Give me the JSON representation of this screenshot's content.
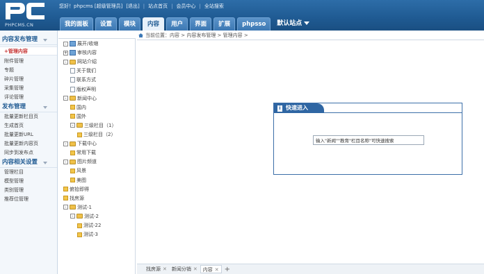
{
  "logo": {
    "brand": "PC",
    "domain": "PHPCMS.CN"
  },
  "userbar": {
    "greeting": "您好！phpcms [超级管理员]",
    "logout": "[退出]",
    "site_home": "站点首页",
    "member_center": "会员中心",
    "search": "全站搜索"
  },
  "nav": {
    "tabs": [
      "我的面板",
      "设置",
      "模块",
      "内容",
      "用户",
      "界面",
      "扩展",
      "phpsso"
    ],
    "active": "内容",
    "site_select": "默认站点"
  },
  "sidebar": {
    "sections": [
      {
        "title": "内容发布管理",
        "items": [
          "管理内容",
          "附件管理",
          "专题",
          "碎片管理",
          "采集管理",
          "评论管理"
        ],
        "current": "管理内容"
      },
      {
        "title": "发布管理",
        "items": [
          "批量更新栏目页",
          "生成首页",
          "批量更新URL",
          "批量更新内容页",
          "同步到发布点"
        ]
      },
      {
        "title": "内容相关设置",
        "items": [
          "管理栏目",
          "模型管理",
          "类别管理",
          "推荐位管理"
        ]
      }
    ]
  },
  "tree": {
    "nodes": [
      {
        "label": "展开/收缩",
        "indent": 0,
        "kind": "toggle"
      },
      {
        "label": "审核内容",
        "indent": 0,
        "kind": "page"
      },
      {
        "label": "网站介绍",
        "indent": 0,
        "kind": "folder"
      },
      {
        "label": "关于我们",
        "indent": 1,
        "kind": "doc"
      },
      {
        "label": "联系方式",
        "indent": 1,
        "kind": "doc"
      },
      {
        "label": "版权声明",
        "indent": 1,
        "kind": "doc"
      },
      {
        "label": "新闻中心",
        "indent": 0,
        "kind": "folder"
      },
      {
        "label": "国内",
        "indent": 1,
        "kind": "leaf"
      },
      {
        "label": "国外",
        "indent": 1,
        "kind": "leaf"
      },
      {
        "label": "三级栏目（1）",
        "indent": 1,
        "kind": "folder"
      },
      {
        "label": "三级栏目（2）",
        "indent": 2,
        "kind": "leaf"
      },
      {
        "label": "下载中心",
        "indent": 0,
        "kind": "folder"
      },
      {
        "label": "常用下载",
        "indent": 1,
        "kind": "leaf"
      },
      {
        "label": "图片频道",
        "indent": 0,
        "kind": "folder"
      },
      {
        "label": "风景",
        "indent": 1,
        "kind": "leaf"
      },
      {
        "label": "美图",
        "indent": 1,
        "kind": "leaf"
      },
      {
        "label": "俯拾即得",
        "indent": 0,
        "kind": "leaf"
      },
      {
        "label": "找房源",
        "indent": 0,
        "kind": "leaf"
      },
      {
        "label": "测试-1",
        "indent": 0,
        "kind": "folder"
      },
      {
        "label": "测试-2",
        "indent": 1,
        "kind": "folder"
      },
      {
        "label": "测试-22",
        "indent": 2,
        "kind": "leaf"
      },
      {
        "label": "测试-3",
        "indent": 2,
        "kind": "leaf"
      }
    ]
  },
  "breadcrumb": "当前位置：内容 > 内容发布管理 > 管理内容 >",
  "quick": {
    "title": "快速进入",
    "placeholder": "输入\"新闻\"\"教育\"栏目名称\"可快速搜索"
  },
  "bottom_tabs": [
    {
      "label": "找房源",
      "active": false
    },
    {
      "label": "新闻分销",
      "active": false
    },
    {
      "label": "内容",
      "active": true
    }
  ],
  "colors": {
    "header": "#1f5a92",
    "accent": "#2f66a3",
    "current_item": "#c53232"
  }
}
